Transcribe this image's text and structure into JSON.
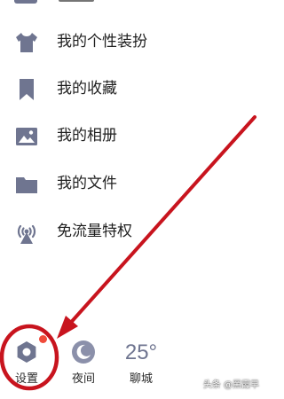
{
  "menu": {
    "items": [
      {
        "label": "我的个性装扮",
        "icon": "shirt-icon"
      },
      {
        "label": "我的收藏",
        "icon": "bookmark-icon"
      },
      {
        "label": "我的相册",
        "icon": "image-icon"
      },
      {
        "label": "我的文件",
        "icon": "folder-icon"
      },
      {
        "label": "免流量特权",
        "icon": "signal-tower-icon"
      }
    ]
  },
  "bottom_bar": {
    "settings_label": "设置",
    "night_label": "夜间",
    "weather_temp": "25°",
    "weather_city": "聊城"
  },
  "watermark": "头条 @黑霞早",
  "colors": {
    "icon": "#6f7590",
    "annotation": "#c8141e",
    "badge": "#f04b3a"
  }
}
